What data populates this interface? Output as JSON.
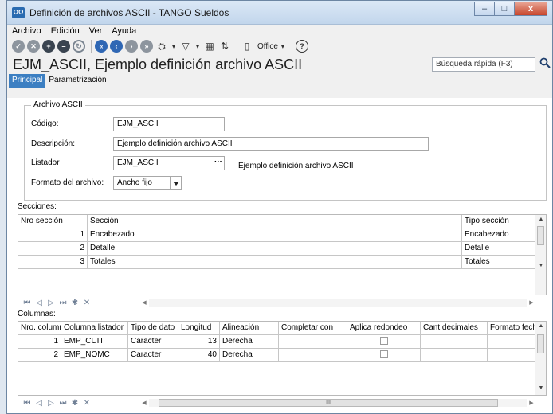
{
  "window": {
    "title": "Definición de archivos ASCII - TANGO Sueldos",
    "app_icon_text": "ΩΩ",
    "minimize": "–",
    "maximize": "□",
    "close": "x"
  },
  "menu": [
    "Archivo",
    "Edición",
    "Ver",
    "Ayuda"
  ],
  "toolbar": {
    "office_label": "Office"
  },
  "header": {
    "record_title": "EJM_ASCII, Ejemplo definición archivo ASCII",
    "quick_search_placeholder": "Búsqueda rápida (F3)"
  },
  "tabs": [
    {
      "label": "Principal",
      "active": true
    },
    {
      "label": "Parametrización",
      "active": false
    }
  ],
  "archivo": {
    "legend": "Archivo ASCII",
    "codigo_label": "Código:",
    "codigo_value": "EJM_ASCII",
    "descripcion_label": "Descripción:",
    "descripcion_value": "Ejemplo definición archivo ASCII",
    "listador_label": "Listador",
    "listador_value": "EJM_ASCII",
    "listador_btn": "···",
    "listador_desc": "Ejemplo definición archivo ASCII",
    "formato_label": "Formato del archivo:",
    "formato_value": "Ancho fijo"
  },
  "secciones": {
    "label": "Secciones:",
    "headers": [
      "Nro sección",
      "Sección",
      "Tipo sección"
    ],
    "rows": [
      {
        "nro": "1",
        "seccion": "Encabezado",
        "tipo": "Encabezado"
      },
      {
        "nro": "2",
        "seccion": "Detalle",
        "tipo": "Detalle"
      },
      {
        "nro": "3",
        "seccion": "Totales",
        "tipo": "Totales"
      }
    ]
  },
  "columnas": {
    "label": "Columnas:",
    "headers": [
      "Nro. columna",
      "Columna listador",
      "Tipo de dato",
      "Longitud",
      "Alineación",
      "Completar con",
      "Aplica redondeo",
      "Cant decimales",
      "Formato fecha"
    ],
    "rows": [
      {
        "nro": "1",
        "columna": "EMP_CUIT",
        "tipo": "Caracter",
        "longitud": "13",
        "alineacion": "Derecha",
        "completar": "",
        "redondeo": false,
        "decimales": "",
        "formato": ""
      },
      {
        "nro": "2",
        "columna": "EMP_NOMC",
        "tipo": "Caracter",
        "longitud": "40",
        "alineacion": "Derecha",
        "completar": "",
        "redondeo": false,
        "decimales": "",
        "formato": ""
      }
    ]
  },
  "nav": [
    "⏮",
    "◁",
    "▷",
    "⏭",
    "✱",
    "✕"
  ],
  "hscroll_thumb": "III"
}
